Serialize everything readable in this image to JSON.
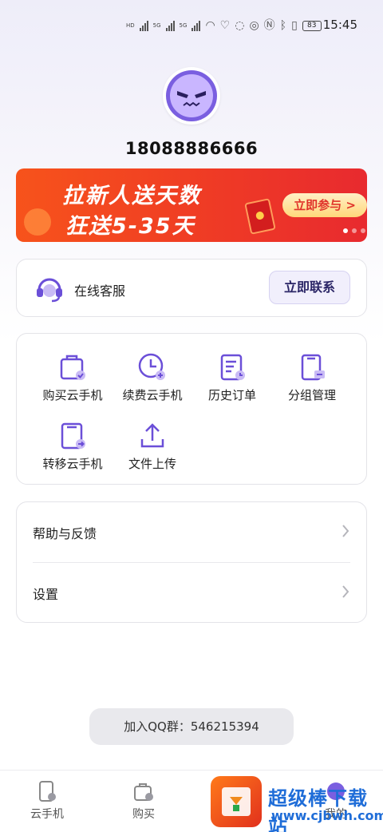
{
  "status_bar": {
    "network_labels": [
      "HD",
      "5G",
      "5G"
    ],
    "battery": "83",
    "time": "15:45"
  },
  "profile": {
    "phone": "18088886666"
  },
  "banner": {
    "line1": "拉新人送天数",
    "line2": "狂送5-35天",
    "cta": "立即参与 >"
  },
  "service": {
    "label": "在线客服",
    "button": "立即联系"
  },
  "features": [
    {
      "label": "购买云手机",
      "icon": "shopping-bag-icon"
    },
    {
      "label": "续费云手机",
      "icon": "clock-plus-icon"
    },
    {
      "label": "历史订单",
      "icon": "order-history-icon"
    },
    {
      "label": "分组管理",
      "icon": "group-manage-icon"
    },
    {
      "label": "转移云手机",
      "icon": "transfer-icon"
    },
    {
      "label": "文件上传",
      "icon": "upload-icon"
    }
  ],
  "menu": [
    {
      "label": "帮助与反馈"
    },
    {
      "label": "设置"
    }
  ],
  "qq_group": "加入QQ群：546215394",
  "tabs": [
    {
      "label": "云手机",
      "icon": "cloud-phone-icon"
    },
    {
      "label": "购买",
      "icon": "shopping-bag-icon"
    },
    {
      "label": "我的",
      "icon": "profile-icon"
    }
  ],
  "watermark": {
    "title": "超级棒下载站",
    "url": "www.cjbwh.com"
  },
  "colors": {
    "accent": "#6b4fd8",
    "banner": "#ef3b25",
    "text": "#222222"
  }
}
